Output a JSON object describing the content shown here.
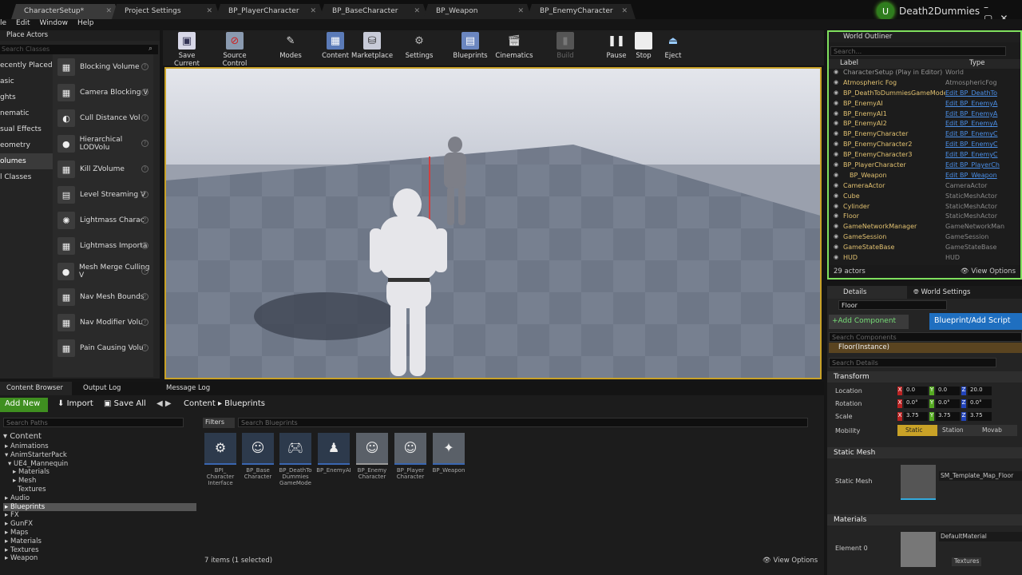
{
  "tabs": [
    {
      "label": "CharacterSetup*"
    },
    {
      "label": "Project Settings"
    },
    {
      "label": "BP_PlayerCharacter"
    },
    {
      "label": "BP_BaseCharacter"
    },
    {
      "label": "BP_Weapon"
    },
    {
      "label": "BP_EnemyCharacter"
    }
  ],
  "brand": "Death2Dummies",
  "menu": [
    "le",
    "Edit",
    "Window",
    "Help"
  ],
  "place_actors": {
    "title": "Place Actors",
    "search_placeholder": "Search Classes",
    "categories": [
      "ecently Placed",
      "asic",
      "ghts",
      "nematic",
      "sual Effects",
      "eometry",
      "olumes",
      "l Classes"
    ],
    "items": [
      "Blocking Volume",
      "Camera Blocking V",
      "Cull Distance Vol",
      "Hierarchical LODVolu",
      "Kill ZVolume",
      "Level Streaming V",
      "Lightmass Charac",
      "Lightmass Importa",
      "Mesh Merge Culling V",
      "Nav Mesh Bounds",
      "Nav Modifier Volu",
      "Pain Causing Volu"
    ]
  },
  "toolbar": [
    "Save Current",
    "Source Control",
    "Modes",
    "Content",
    "Marketplace",
    "Settings",
    "Blueprints",
    "Cinematics",
    "Build",
    "Pause",
    "Stop",
    "Eject"
  ],
  "outliner": {
    "title": "World Outliner",
    "search_placeholder": "Search...",
    "col_label": "Label",
    "col_type": "Type",
    "count": "29 actors",
    "view_options": "View Options",
    "rows": [
      {
        "label": "CharacterSetup (Play in Editor)",
        "type": "World",
        "link": false
      },
      {
        "label": "Atmospheric Fog",
        "type": "AtmosphericFog",
        "link": false
      },
      {
        "label": "BP_DeathToDummiesGameMode",
        "type": "Edit BP_DeathTo",
        "link": true
      },
      {
        "label": "BP_EnemyAI",
        "type": "Edit BP_EnemyA",
        "link": true
      },
      {
        "label": "BP_EnemyAI1",
        "type": "Edit BP_EnemyA",
        "link": true
      },
      {
        "label": "BP_EnemyAI2",
        "type": "Edit BP_EnemyA",
        "link": true
      },
      {
        "label": "BP_EnemyCharacter",
        "type": "Edit BP_EnemyC",
        "link": true
      },
      {
        "label": "BP_EnemyCharacter2",
        "type": "Edit BP_EnemyC",
        "link": true
      },
      {
        "label": "BP_EnemyCharacter3",
        "type": "Edit BP_EnemyC",
        "link": true
      },
      {
        "label": "BP_PlayerCharacter",
        "type": "Edit BP_PlayerCh",
        "link": true
      },
      {
        "label": "BP_Weapon",
        "type": "Edit BP_Weapon",
        "link": true
      },
      {
        "label": "CameraActor",
        "type": "CameraActor",
        "link": false
      },
      {
        "label": "Cube",
        "type": "StaticMeshActor",
        "link": false
      },
      {
        "label": "Cylinder",
        "type": "StaticMeshActor",
        "link": false
      },
      {
        "label": "Floor",
        "type": "StaticMeshActor",
        "link": false
      },
      {
        "label": "GameNetworkManager",
        "type": "GameNetworkMan",
        "link": false
      },
      {
        "label": "GameSession",
        "type": "GameSession",
        "link": false
      },
      {
        "label": "GameStateBase",
        "type": "GameStateBase",
        "link": false
      },
      {
        "label": "HUD",
        "type": "HUD",
        "link": false
      }
    ]
  },
  "details": {
    "tab1": "Details",
    "tab2": "World Settings",
    "name": "Floor",
    "add_component": "+Add Component",
    "blueprint_btn": "Blueprint/Add Script",
    "search_components": "Search Components",
    "instance": "Floor(Instance)",
    "search_details": "Search Details",
    "transform": "Transform",
    "location": "Location",
    "rotation": "Rotation",
    "scale": "Scale",
    "mobility": "Mobility",
    "loc": [
      "0.0",
      "0.0",
      "20.0"
    ],
    "rot": [
      "0.0°",
      "0.0°",
      "0.0°"
    ],
    "scl": [
      "3.75",
      "3.75",
      "3.75"
    ],
    "mob": [
      "Static",
      "Station",
      "Movab"
    ],
    "static_mesh_section": "Static Mesh",
    "static_mesh_label": "Static Mesh",
    "static_mesh_value": "SM_Template_Map_Floor",
    "materials_section": "Materials",
    "element0": "Element 0",
    "material_value": "DefaultMaterial",
    "textures": "Textures"
  },
  "cb": {
    "tab1": "Content Browser",
    "tab2": "Output Log",
    "tab3": "Message Log",
    "add_new": "Add New",
    "import": "Import",
    "save_all": "Save All",
    "crumb1": "Content",
    "crumb2": "Blueprints",
    "search_paths": "Search Paths",
    "filters": "Filters",
    "search_bp": "Search Blueprints",
    "count": "7 items (1 selected)",
    "view_options": "View Options",
    "tree": [
      "Content",
      "Animations",
      "AnimStarterPack",
      "UE4_Mannequin",
      "Materials",
      "Mesh",
      "Textures",
      "Audio",
      "Blueprints",
      "FX",
      "GunFX",
      "Maps",
      "Materials",
      "Textures",
      "Weapon"
    ],
    "assets": [
      "BPI_ Character Interface",
      "BP_Base Character",
      "BP_DeathTo Dummies GameMode",
      "BP_EnemyAI",
      "BP_Enemy Character",
      "BP_Player Character",
      "BP_Weapon"
    ]
  }
}
